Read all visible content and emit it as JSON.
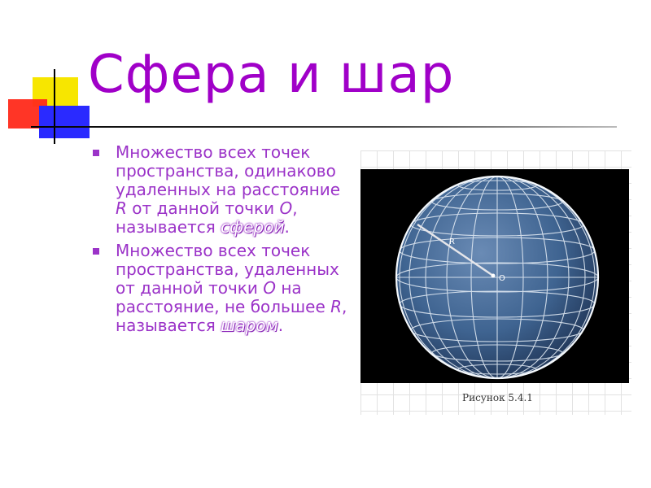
{
  "title": "Сфера и шар",
  "bullets": [
    {
      "before": "Множество всех точек пространства, одинаково удаленных на расстояние ",
      "var1": "R",
      "middle": " от данной точки ",
      "var2": "O",
      "after": ", называется ",
      "term": "сферой",
      "end": "."
    },
    {
      "before": "Множество всех точек пространства, удаленных от данной точки ",
      "var1": "O",
      "middle": " на расстояние, не большее ",
      "var2": "R",
      "after": ", называется ",
      "term": "шаром",
      "end": "."
    }
  ],
  "figure": {
    "radius_label": "R",
    "center_label": "O",
    "caption": "Рисунок 5.4.1"
  },
  "colors": {
    "title": "#a000c8",
    "text": "#9b33c8",
    "sphere_background": "#000000",
    "sphere_fill": "#3f6491"
  }
}
